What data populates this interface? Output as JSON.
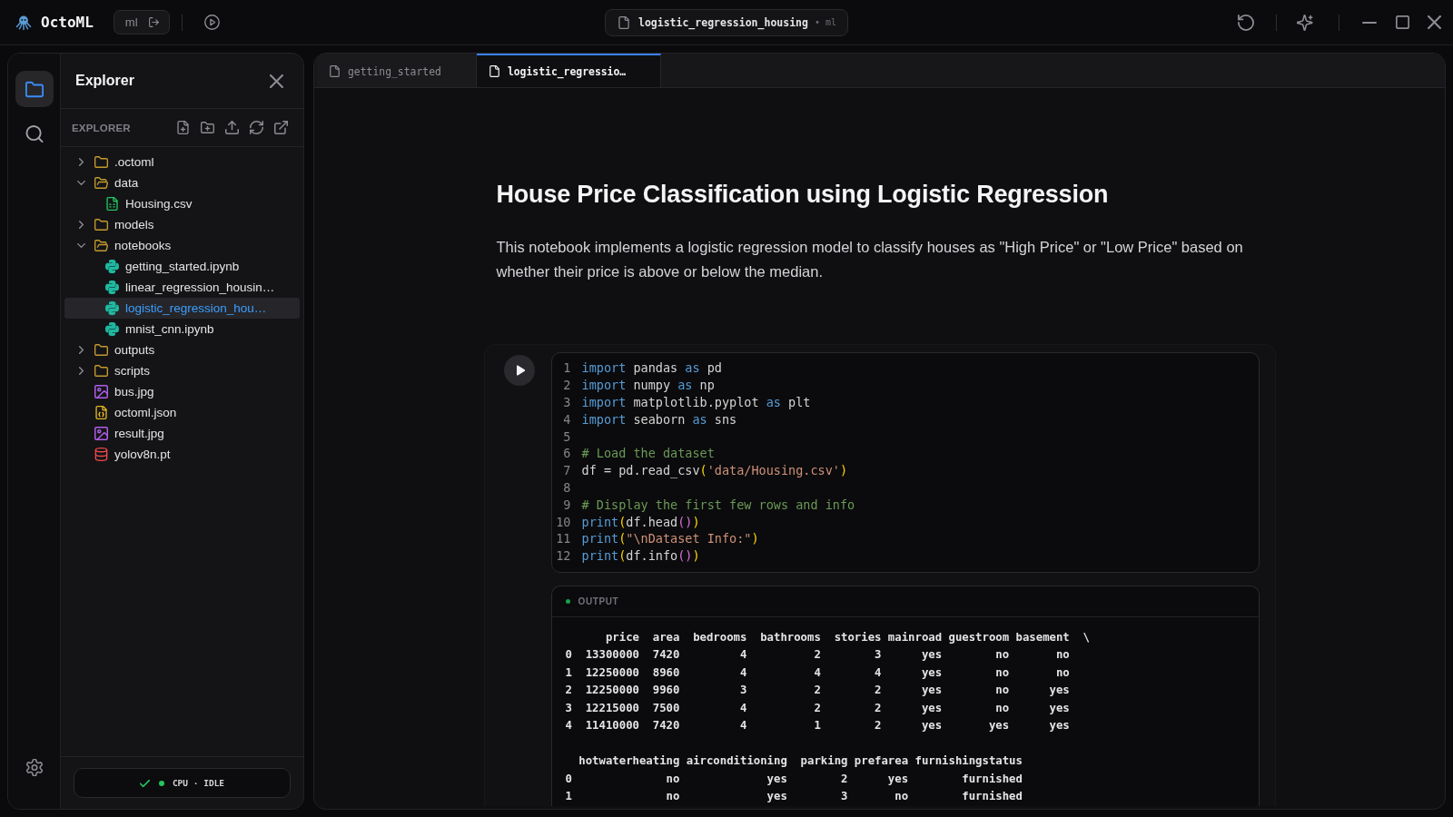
{
  "app": {
    "name": "OctoML",
    "environment": "ml"
  },
  "document": {
    "title": "logistic_regression_housing",
    "kernel": "• ml"
  },
  "activity_bar": [
    {
      "kind": "files",
      "selected": true
    },
    {
      "kind": "search",
      "selected": false
    }
  ],
  "explorer": {
    "title": "Explorer",
    "section": "EXPLORER",
    "tree": [
      {
        "name": ".octoml",
        "kind": "folder",
        "expanded": false,
        "selected": false
      },
      {
        "name": "data",
        "kind": "folder",
        "expanded": true,
        "selected": false,
        "children": [
          {
            "name": "Housing.csv",
            "kind": "csv",
            "selected": false
          }
        ]
      },
      {
        "name": "models",
        "kind": "folder",
        "expanded": false,
        "selected": false
      },
      {
        "name": "notebooks",
        "kind": "folder",
        "expanded": true,
        "selected": false,
        "children": [
          {
            "name": "getting_started.ipynb",
            "kind": "notebook",
            "selected": false
          },
          {
            "name": "linear_regression_housin…",
            "kind": "notebook",
            "selected": false
          },
          {
            "name": "logistic_regression_hou…",
            "kind": "notebook",
            "selected": true
          },
          {
            "name": "mnist_cnn.ipynb",
            "kind": "notebook",
            "selected": false
          }
        ]
      },
      {
        "name": "outputs",
        "kind": "folder",
        "expanded": false,
        "selected": false
      },
      {
        "name": "scripts",
        "kind": "folder",
        "expanded": false,
        "selected": false
      },
      {
        "name": "bus.jpg",
        "kind": "image",
        "selected": false
      },
      {
        "name": "octoml.json",
        "kind": "json",
        "selected": false
      },
      {
        "name": "result.jpg",
        "kind": "image",
        "selected": false
      },
      {
        "name": "yolov8n.pt",
        "kind": "model",
        "selected": false
      }
    ]
  },
  "runtime": {
    "ready": true,
    "text": "CPU · IDLE"
  },
  "tabs": [
    {
      "label": "getting_started",
      "selected": false
    },
    {
      "label": "logistic_regressio…",
      "selected": true
    }
  ],
  "notebook": {
    "cells": [
      {
        "kind": "markdown",
        "heading": "House Price Classification using Logistic Regression",
        "text": "This notebook implements a logistic regression model to classify houses as \"High Price\" or \"Low Price\" based on whether their price is above or below the median."
      },
      {
        "kind": "code",
        "lines": [
          {
            "number": "1",
            "tokens": [
              {
                "text": "import",
                "kind": "keyword"
              },
              {
                "text": " pandas ",
                "kind": "plain"
              },
              {
                "text": "as",
                "kind": "keyword"
              },
              {
                "text": " pd",
                "kind": "plain"
              }
            ]
          },
          {
            "number": "2",
            "tokens": [
              {
                "text": "import",
                "kind": "keyword"
              },
              {
                "text": " numpy ",
                "kind": "plain"
              },
              {
                "text": "as",
                "kind": "keyword"
              },
              {
                "text": " np",
                "kind": "plain"
              }
            ]
          },
          {
            "number": "3",
            "tokens": [
              {
                "text": "import",
                "kind": "keyword"
              },
              {
                "text": " matplotlib.pyplot ",
                "kind": "plain"
              },
              {
                "text": "as",
                "kind": "keyword"
              },
              {
                "text": " plt",
                "kind": "plain"
              }
            ]
          },
          {
            "number": "4",
            "tokens": [
              {
                "text": "import",
                "kind": "keyword"
              },
              {
                "text": " seaborn ",
                "kind": "plain"
              },
              {
                "text": "as",
                "kind": "keyword"
              },
              {
                "text": " sns",
                "kind": "plain"
              }
            ]
          },
          {
            "number": "5"
          },
          {
            "number": "6",
            "tokens": [
              {
                "text": "# Load the dataset",
                "kind": "comment"
              }
            ]
          },
          {
            "number": "7",
            "tokens": [
              {
                "text": "df = pd.read_csv",
                "kind": "plain"
              },
              {
                "text": "(",
                "kind": "bracket"
              },
              {
                "text": "'data/Housing.csv'",
                "kind": "string"
              },
              {
                "text": ")",
                "kind": "bracket"
              }
            ]
          },
          {
            "number": "8"
          },
          {
            "number": "9",
            "tokens": [
              {
                "text": "# Display the first few rows and info",
                "kind": "comment"
              }
            ]
          },
          {
            "number": "10",
            "tokens": [
              {
                "text": "print",
                "kind": "keyword"
              },
              {
                "text": "(",
                "kind": "bracket"
              },
              {
                "text": "df.head",
                "kind": "plain"
              },
              {
                "text": "()",
                "kind": "subbracket"
              },
              {
                "text": ")",
                "kind": "bracket"
              }
            ]
          },
          {
            "number": "11",
            "tokens": [
              {
                "text": "print",
                "kind": "keyword"
              },
              {
                "text": "(",
                "kind": "bracket"
              },
              {
                "text": "\"\\nDataset Info:\"",
                "kind": "string"
              },
              {
                "text": ")",
                "kind": "bracket"
              }
            ]
          },
          {
            "number": "12",
            "tokens": [
              {
                "text": "print",
                "kind": "keyword"
              },
              {
                "text": "(",
                "kind": "bracket"
              },
              {
                "text": "df.info",
                "kind": "plain"
              },
              {
                "text": "()",
                "kind": "subbracket"
              },
              {
                "text": ")",
                "kind": "bracket"
              }
            ]
          }
        ],
        "output": {
          "label": "OUTPUT",
          "blocks": [
            {
              "lines": [
                "      price  area  bedrooms  bathrooms  stories mainroad guestroom basement  \\",
                "0  13300000  7420         4          2        3      yes        no       no",
                "1  12250000  8960         4          4        4      yes        no       no",
                "2  12250000  9960         3          2        2      yes        no      yes",
                "3  12215000  7500         4          2        2      yes        no      yes",
                "4  11410000  7420         4          1        2      yes       yes      yes"
              ]
            },
            {
              "lines": [
                "  hotwaterheating airconditioning  parking prefarea furnishingstatus",
                "0              no             yes        2      yes        furnished",
                "1              no             yes        3       no        furnished"
              ]
            }
          ]
        }
      }
    ]
  }
}
